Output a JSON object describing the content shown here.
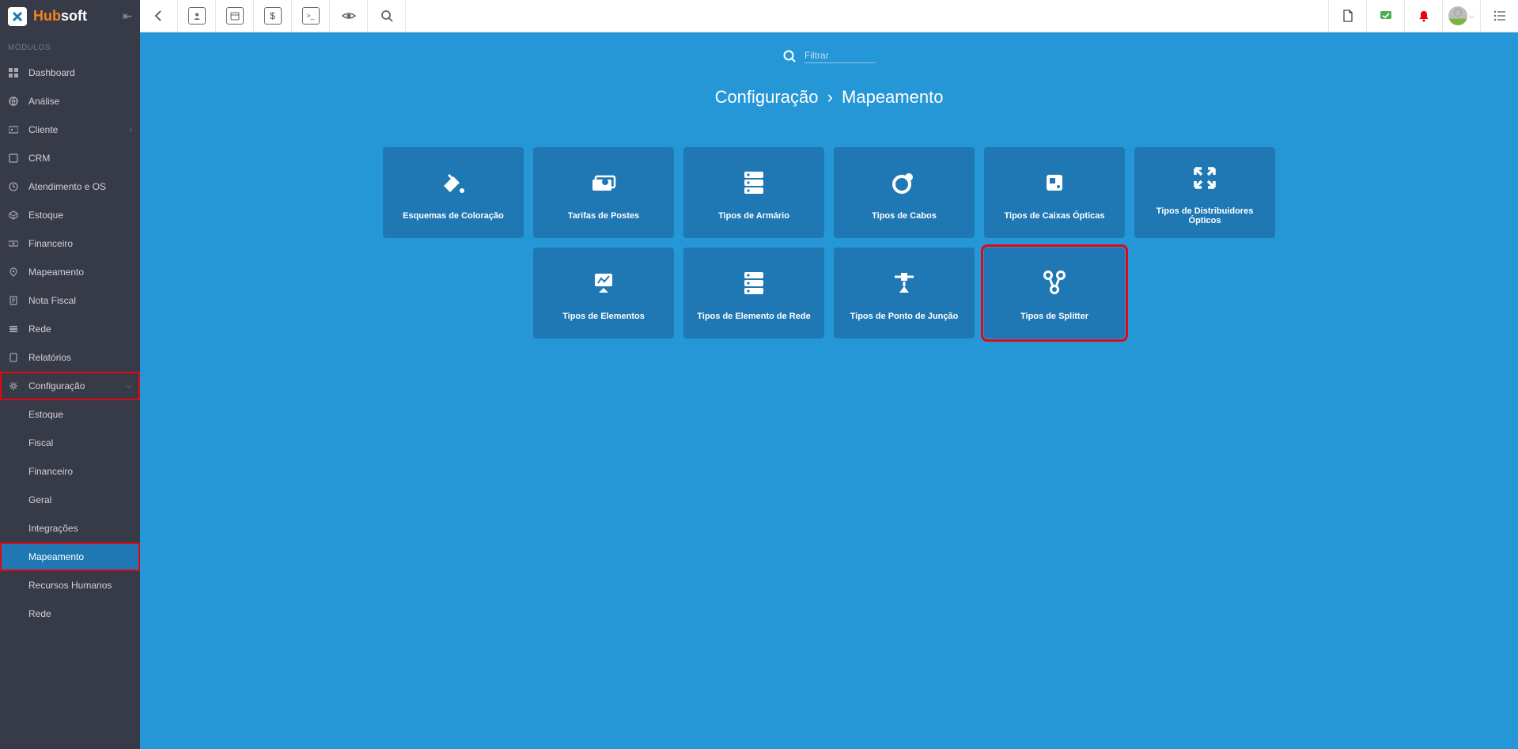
{
  "brand": {
    "a": "Hub",
    "b": "soft"
  },
  "sidebar": {
    "section_label": "MÓDULOS",
    "items": [
      {
        "label": "Dashboard"
      },
      {
        "label": "Análise"
      },
      {
        "label": "Cliente",
        "chevron": "›"
      },
      {
        "label": "CRM"
      },
      {
        "label": "Atendimento e OS"
      },
      {
        "label": "Estoque"
      },
      {
        "label": "Financeiro"
      },
      {
        "label": "Mapeamento"
      },
      {
        "label": "Nota Fiscal"
      },
      {
        "label": "Rede"
      },
      {
        "label": "Relatórios"
      },
      {
        "label": "Configuração",
        "chevron": "⌵"
      }
    ],
    "sub_items": [
      {
        "label": "Estoque"
      },
      {
        "label": "Fiscal"
      },
      {
        "label": "Financeiro"
      },
      {
        "label": "Geral"
      },
      {
        "label": "Integrações"
      },
      {
        "label": "Mapeamento"
      },
      {
        "label": "Recursos Humanos"
      },
      {
        "label": "Rede"
      }
    ]
  },
  "search": {
    "placeholder": "Filtrar"
  },
  "breadcrumb": {
    "a": "Configuração",
    "sep": "›",
    "b": "Mapeamento"
  },
  "cards": [
    {
      "label": "Esquemas de Coloração"
    },
    {
      "label": "Tarifas de Postes"
    },
    {
      "label": "Tipos de Armário"
    },
    {
      "label": "Tipos de Cabos"
    },
    {
      "label": "Tipos de Caixas Ópticas"
    },
    {
      "label": "Tipos de Distribuidores Ópticos"
    },
    {
      "label": "Tipos de Elementos"
    },
    {
      "label": "Tipos de Elemento de Rede"
    },
    {
      "label": "Tipos de Ponto de Junção"
    },
    {
      "label": "Tipos de Splitter"
    }
  ]
}
